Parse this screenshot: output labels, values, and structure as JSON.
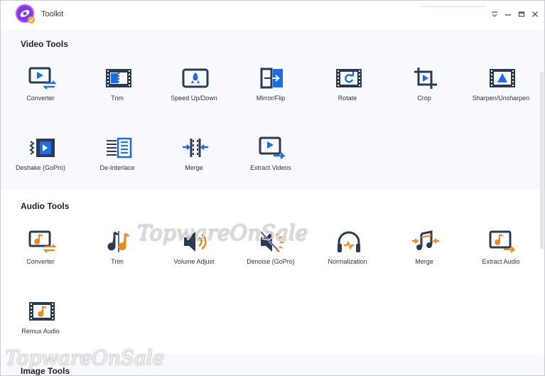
{
  "window": {
    "title": "Toolkit"
  },
  "titlebar": {
    "dropdown_icon": "dropdown-icon",
    "minimize_icon": "minimize-icon",
    "maximize_icon": "maximize-icon",
    "close_icon": "close-icon"
  },
  "colors": {
    "blue": "#1a6fe8",
    "dark": "#2b3a55",
    "orange": "#f0891d"
  },
  "video": {
    "title": "Video Tools",
    "tools": [
      {
        "label": "Converter",
        "icon": "video-converter-icon"
      },
      {
        "label": "Trim",
        "icon": "film-trim-icon"
      },
      {
        "label": "Speed Up/Down",
        "icon": "rocket-icon"
      },
      {
        "label": "Mirror/Flip",
        "icon": "mirror-flip-icon"
      },
      {
        "label": "Rotate",
        "icon": "rotate-icon"
      },
      {
        "label": "Crop",
        "icon": "crop-icon"
      },
      {
        "label": "Sharpen/Unsharpen",
        "icon": "sharpen-icon"
      },
      {
        "label": "Deshake (GoPro)",
        "icon": "deshake-icon"
      },
      {
        "label": "De-Interlace",
        "icon": "deinterlace-icon"
      },
      {
        "label": "Merge",
        "icon": "video-merge-icon"
      },
      {
        "label": "Extract Videos",
        "icon": "extract-video-icon"
      }
    ]
  },
  "audio": {
    "title": "Audio Tools",
    "tools": [
      {
        "label": "Converter",
        "icon": "audio-converter-icon"
      },
      {
        "label": "Trim",
        "icon": "audio-trim-icon"
      },
      {
        "label": "Volume Adjust",
        "icon": "volume-icon"
      },
      {
        "label": "Denoise (GoPro)",
        "icon": "denoise-icon"
      },
      {
        "label": "Normalization",
        "icon": "headphones-icon"
      },
      {
        "label": "Merge",
        "icon": "audio-merge-icon"
      },
      {
        "label": "Extract Audio",
        "icon": "extract-audio-icon"
      },
      {
        "label": "Remux Audio",
        "icon": "remux-audio-icon"
      }
    ]
  },
  "image": {
    "title": "Image Tools"
  },
  "watermark": {
    "text": "TopwareOnSale"
  }
}
